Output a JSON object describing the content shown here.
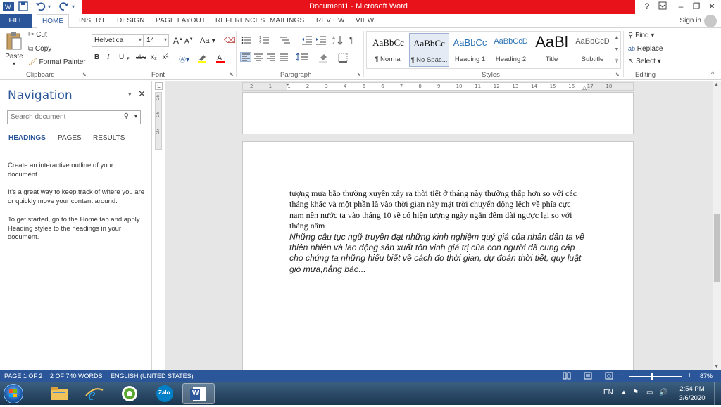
{
  "window": {
    "title": "Document1 - Microsoft Word",
    "help": "?",
    "minimize": "–",
    "restore": "❐",
    "close": "✕"
  },
  "tabs": {
    "file": "FILE",
    "items": [
      "HOME",
      "INSERT",
      "DESIGN",
      "PAGE LAYOUT",
      "REFERENCES",
      "MAILINGS",
      "REVIEW",
      "VIEW"
    ],
    "signin": "Sign in"
  },
  "ribbon": {
    "clipboard": {
      "label": "Clipboard",
      "paste": "Paste",
      "cut": "Cut",
      "copy": "Copy",
      "format_painter": "Format Painter"
    },
    "font": {
      "label": "Font",
      "family": "Helvetica",
      "size": "14",
      "grow": "A",
      "shrink": "A",
      "case": "Aa",
      "bold": "B",
      "italic": "I",
      "underline": "U",
      "strike": "abc",
      "subscript": "x₂",
      "superscript": "x²"
    },
    "paragraph": {
      "label": "Paragraph"
    },
    "styles": {
      "label": "Styles",
      "items": [
        {
          "sample": "AaBbCc",
          "name": "¶ Normal"
        },
        {
          "sample": "AaBbCc",
          "name": "¶ No Spac..."
        },
        {
          "sample": "AaBbCc",
          "name": "Heading 1"
        },
        {
          "sample": "AaBbCcD",
          "name": "Heading 2"
        },
        {
          "sample": "AaBl",
          "name": "Title"
        },
        {
          "sample": "AaBbCcD",
          "name": "Subtitle"
        }
      ]
    },
    "editing": {
      "label": "Editing",
      "find": "Find",
      "replace": "Replace",
      "select": "Select"
    }
  },
  "nav": {
    "title": "Navigation",
    "search_placeholder": "Search document",
    "tabs": [
      "HEADINGS",
      "PAGES",
      "RESULTS"
    ],
    "p1": "Create an interactive outline of your document.",
    "p2": "It's a great way to keep track of where you are or quickly move your content around.",
    "p3": "To get started, go to the Home tab and apply Heading styles to the headings in your document."
  },
  "ruler": {
    "marks": [
      "2",
      "1",
      "1",
      "2",
      "3",
      "4",
      "5",
      "6",
      "7",
      "8",
      "9",
      "10",
      "11",
      "12",
      "13",
      "14",
      "15",
      "16",
      "17",
      "18"
    ],
    "vmarks": [
      "L",
      "25",
      "26",
      "27"
    ]
  },
  "document": {
    "para1": "tượng mưa bão thường xuyên xảy ra thời tiết ở tháng này thường thấp hơn so với các tháng khác và một phần là vào thời gian này mặt trời chuyển động lệch về phía cực nam nên nước ta vào tháng 10 sẽ có hiện tượng ngày ngắn đêm dài ngược lại so với tháng năm",
    "para2": "Những câu tục ngữ truyền đạt những kinh nghiệm quý giá của nhân dân ta về thiên nhiên và lao động sản xuất tôn vinh giá trị của con người đã cung cấp cho chúng ta những hiểu biết về  cách đo thời gian, dự đoán thời tiết, quy luật gió mưa,nắng bão..."
  },
  "status": {
    "page": "PAGE 1 OF 2",
    "words": "2 OF 740 WORDS",
    "language": "ENGLISH (UNITED STATES)",
    "zoom": "87%",
    "zoom_minus": "−",
    "zoom_plus": "+",
    "zoom_level": 0.87
  },
  "taskbar": {
    "lang": "EN",
    "time": "2:54 PM",
    "date": "3/6/2020",
    "apps": [
      "file-explorer",
      "internet-explorer",
      "coc-coc-browser",
      "zalo",
      "word"
    ],
    "zalo_label": "Zalo",
    "word_label": "W"
  },
  "colors": {
    "accent": "#2b579a",
    "titlebar": "#e8121a"
  }
}
